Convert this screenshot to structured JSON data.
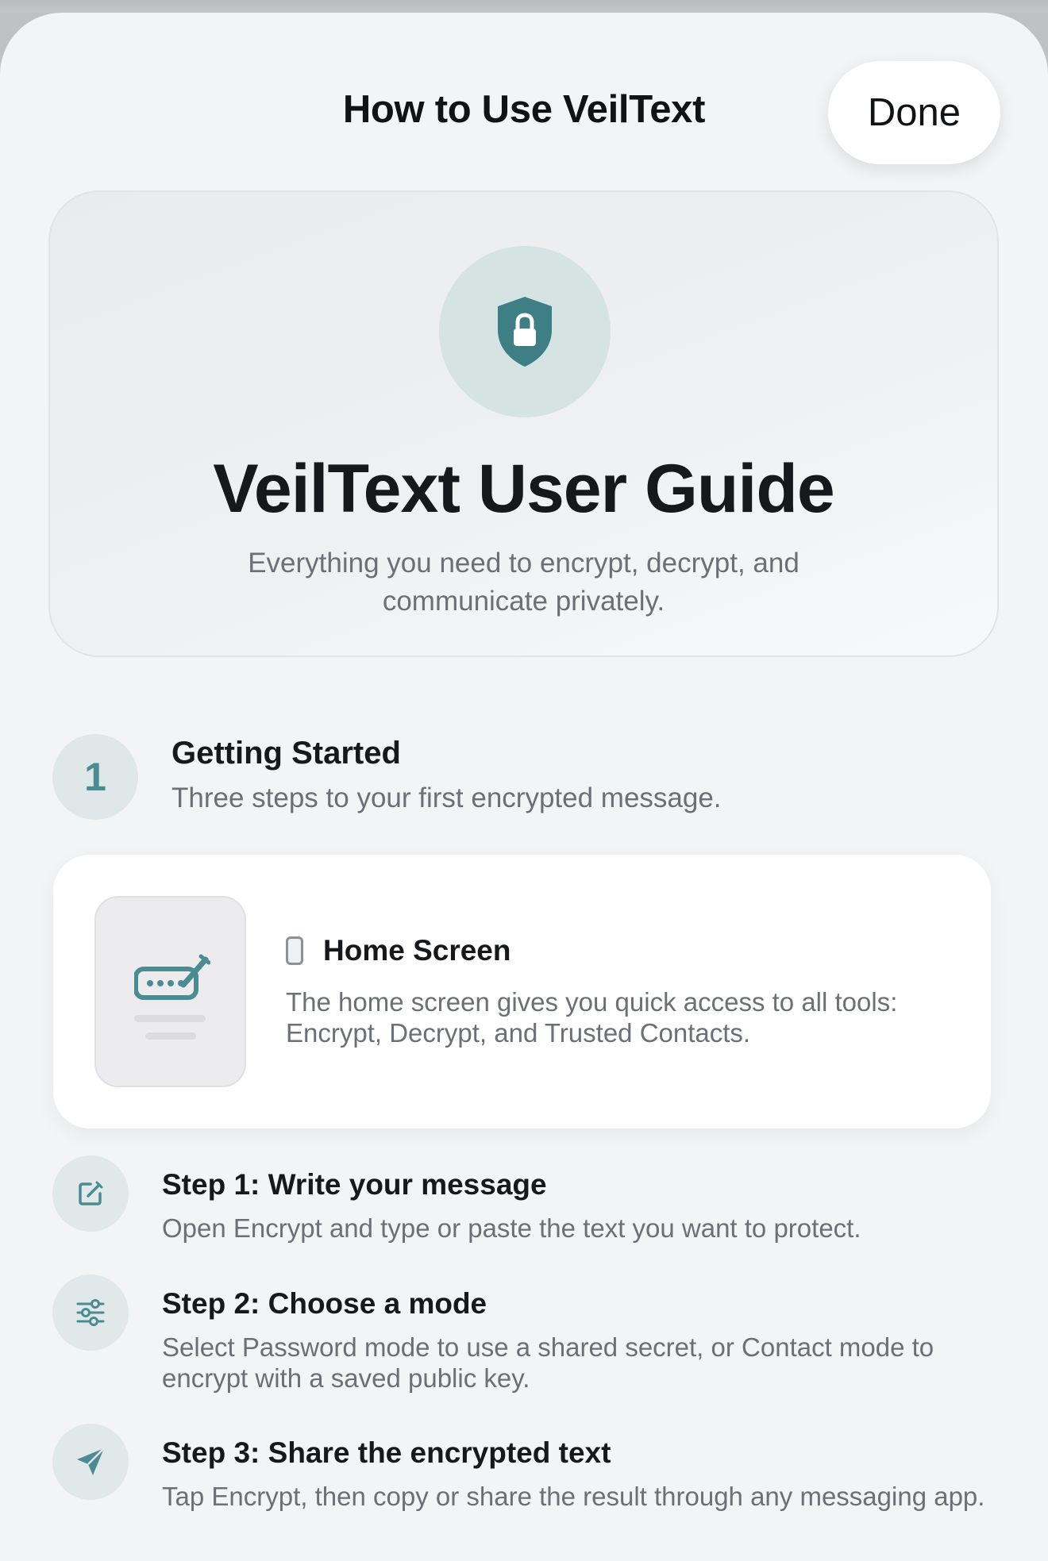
{
  "header": {
    "title": "How to Use VeilText",
    "done_label": "Done"
  },
  "hero": {
    "icon": "lock-shield-icon",
    "title": "VeilText User Guide",
    "subtitle": "Everything you need to encrypt, decrypt, and communicate privately."
  },
  "section": {
    "number": "1",
    "title": "Getting Started",
    "subtitle": "Three steps to your first encrypted message."
  },
  "home_card": {
    "icon": "phone-icon",
    "title": "Home Screen",
    "description": "The home screen gives you quick access to all tools: Encrypt, Decrypt, and Trusted Contacts."
  },
  "steps": [
    {
      "icon": "edit-icon",
      "title": "Step 1: Write your message",
      "description": "Open Encrypt and type or paste the text you want to protect."
    },
    {
      "icon": "sliders-icon",
      "title": "Step 2: Choose a mode",
      "description": "Select Password mode to use a shared secret, or Contact mode to encrypt with a saved public key."
    },
    {
      "icon": "send-icon",
      "title": "Step 3: Share the encrypted text",
      "description": "Tap Encrypt, then copy or share the result through any messaging app."
    }
  ],
  "colors": {
    "accent": "#4b8c93",
    "background": "#f3f4f6",
    "text_primary": "#17181b",
    "text_secondary": "#6c6f75"
  }
}
